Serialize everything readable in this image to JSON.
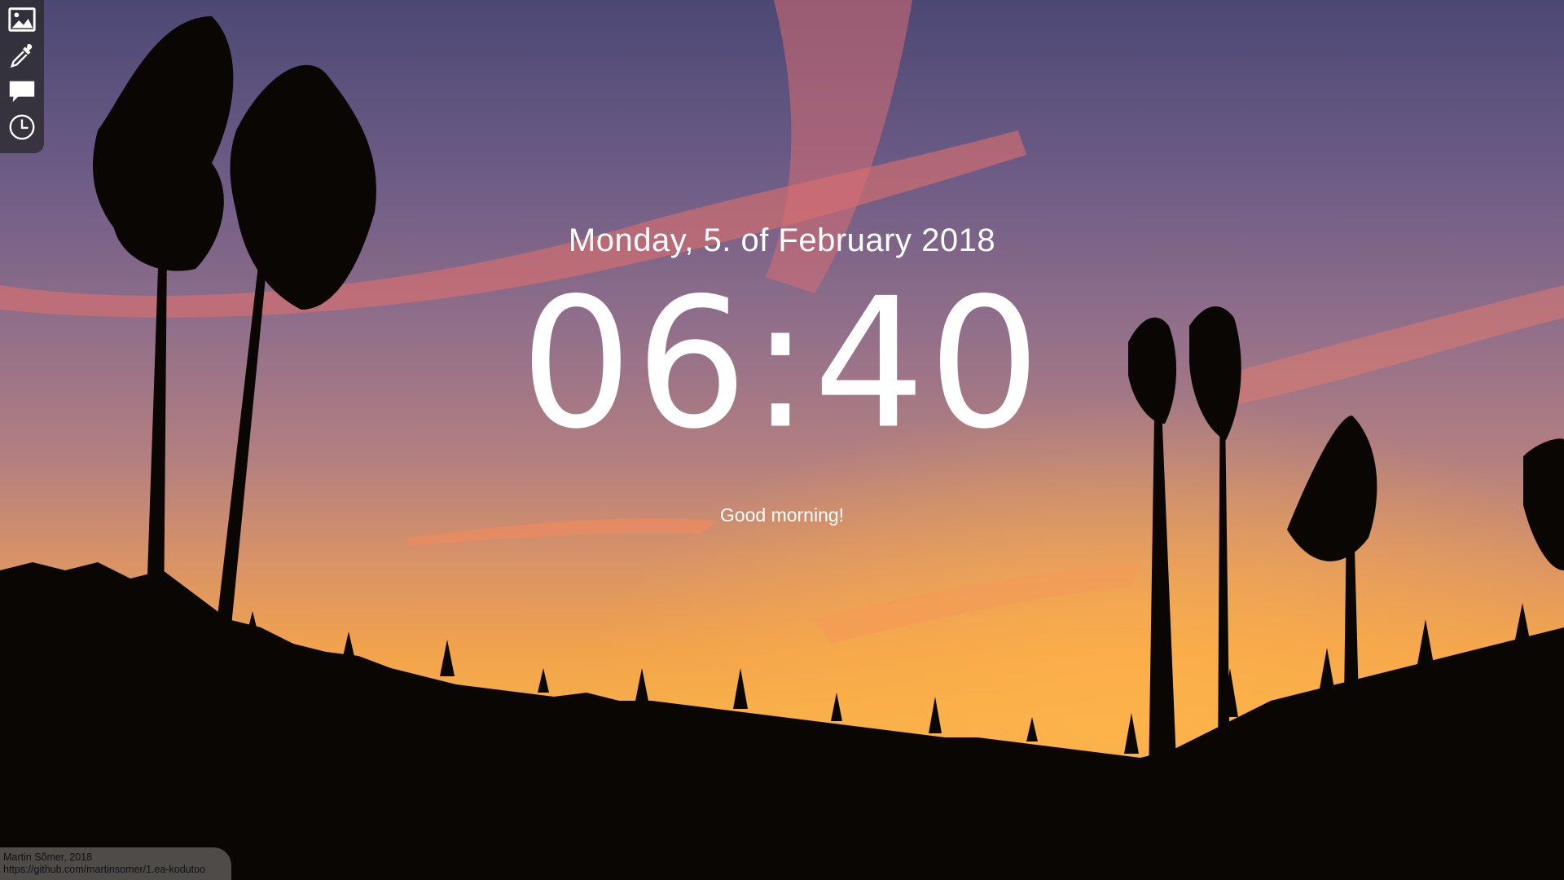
{
  "toolbar": {
    "buttons": [
      {
        "icon": "image-icon"
      },
      {
        "icon": "eyedropper-icon"
      },
      {
        "icon": "speech-bubble-icon"
      },
      {
        "icon": "clock-icon"
      }
    ]
  },
  "clock": {
    "date": "Monday, 5. of February 2018",
    "time": "06:40",
    "greeting": "Good morning!"
  },
  "credit": {
    "author": "Martin Sõmer, 2018",
    "url": "https://github.com/martinsomer/1.ea-kodutoo"
  },
  "colors": {
    "text": "#ffffff",
    "toolbar_bg": "#282828",
    "sky_top": "#4f4a75",
    "sky_horizon": "#f0a24a"
  }
}
